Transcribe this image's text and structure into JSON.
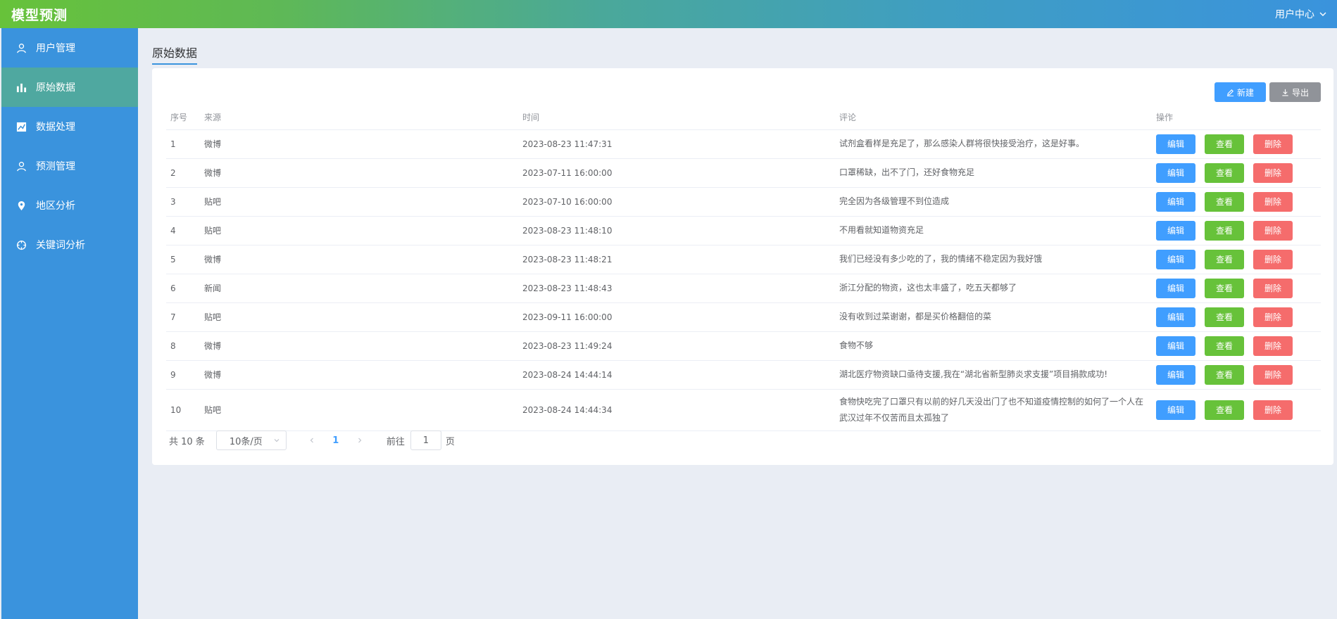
{
  "app": {
    "title": "模型预测",
    "user_center": "用户中心"
  },
  "sidebar": {
    "items": [
      {
        "label": "用户管理",
        "icon": "user-icon"
      },
      {
        "label": "原始数据",
        "icon": "bar-chart-icon",
        "active": true
      },
      {
        "label": "数据处理",
        "icon": "line-chart-icon"
      },
      {
        "label": "预测管理",
        "icon": "user-icon"
      },
      {
        "label": "地区分析",
        "icon": "location-pin-icon"
      },
      {
        "label": "关键词分析",
        "icon": "target-icon"
      }
    ]
  },
  "page": {
    "tab_title": "原始数据"
  },
  "toolbar": {
    "new_label": "新建",
    "export_label": "导出"
  },
  "table": {
    "headers": {
      "index": "序号",
      "source": "来源",
      "time": "时间",
      "comment": "评论",
      "actions": "操作"
    },
    "action_labels": {
      "edit": "编辑",
      "view": "查看",
      "delete": "删除"
    },
    "rows": [
      {
        "index": "1",
        "source": "微博",
        "time": "2023-08-23 11:47:31",
        "comment": "试剂盒看样是充足了，那么感染人群将很快接受治疗，这是好事。"
      },
      {
        "index": "2",
        "source": "微博",
        "time": "2023-07-11 16:00:00",
        "comment": "口罩稀缺，出不了门，还好食物充足"
      },
      {
        "index": "3",
        "source": "贴吧",
        "time": "2023-07-10 16:00:00",
        "comment": "完全因为各级管理不到位造成"
      },
      {
        "index": "4",
        "source": "贴吧",
        "time": "2023-08-23 11:48:10",
        "comment": "不用看就知道物资充足"
      },
      {
        "index": "5",
        "source": "微博",
        "time": "2023-08-23 11:48:21",
        "comment": "我们已经没有多少吃的了，我的情绪不稳定因为我好饿"
      },
      {
        "index": "6",
        "source": "新闻",
        "time": "2023-08-23 11:48:43",
        "comment": "浙江分配的物资，这也太丰盛了，吃五天都够了"
      },
      {
        "index": "7",
        "source": "贴吧",
        "time": "2023-09-11 16:00:00",
        "comment": "没有收到过菜谢谢，都是买价格翻倍的菜"
      },
      {
        "index": "8",
        "source": "微博",
        "time": "2023-08-23 11:49:24",
        "comment": "食物不够"
      },
      {
        "index": "9",
        "source": "微博",
        "time": "2023-08-24 14:44:14",
        "comment": "湖北医疗物资缺口亟待支援,我在“湖北省新型肺炎求支援”项目捐款成功!"
      },
      {
        "index": "10",
        "source": "贴吧",
        "time": "2023-08-24 14:44:34",
        "comment": "食物快吃完了口罩只有以前的好几天没出门了也不知道疫情控制的如何了一个人在武汉过年不仅苦而且太孤独了"
      }
    ]
  },
  "pagination": {
    "total_text": "共 10 条",
    "page_size": "10条/页",
    "current_page": "1",
    "goto_prefix": "前往",
    "goto_value": "1",
    "goto_suffix": "页"
  },
  "colors": {
    "primary": "#409eff",
    "success": "#67c23a",
    "danger": "#f56c6c",
    "info": "#909399",
    "sidebar": "#3a93dd",
    "sidebar_active": "#4fa8a0"
  }
}
